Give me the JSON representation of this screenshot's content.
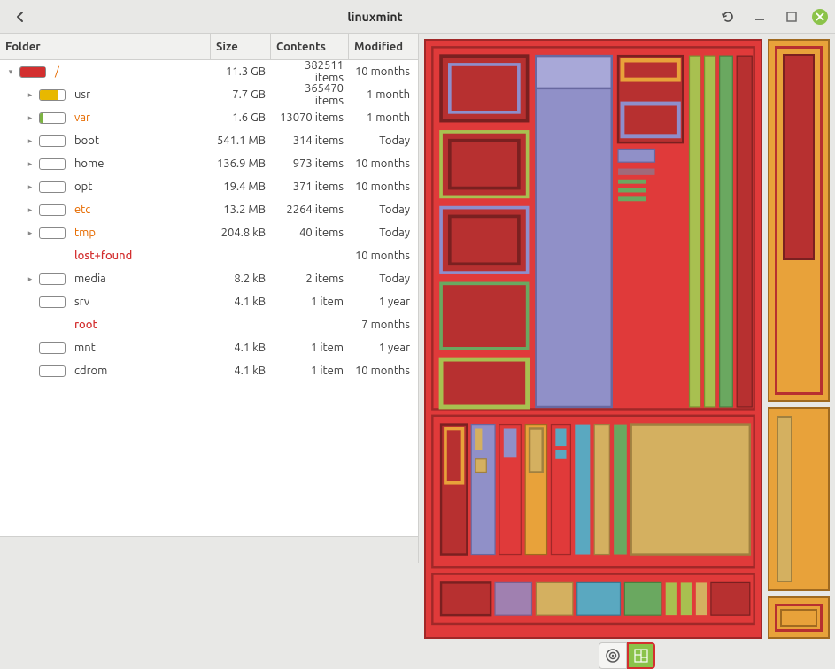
{
  "titlebar": {
    "title": "linuxmint"
  },
  "columns": {
    "folder": "Folder",
    "size": "Size",
    "contents": "Contents",
    "modified": "Modified"
  },
  "rows": [
    {
      "indent": 0,
      "expand": "down",
      "bar_fill": 100,
      "bar_color": "#d32f2f",
      "name": "/",
      "name_class": "orange",
      "size": "11.3 GB",
      "contents": "382511 items",
      "modified": "10 months"
    },
    {
      "indent": 1,
      "expand": "right",
      "bar_fill": 70,
      "bar_color": "#e8b800",
      "name": "usr",
      "name_class": "",
      "size": "7.7 GB",
      "contents": "365470 items",
      "modified": "1 month"
    },
    {
      "indent": 1,
      "expand": "right",
      "bar_fill": 15,
      "bar_color": "#7cb342",
      "name": "var",
      "name_class": "orange",
      "size": "1.6 GB",
      "contents": "13070 items",
      "modified": "1 month"
    },
    {
      "indent": 1,
      "expand": "right",
      "bar_fill": 0,
      "bar_color": "",
      "name": "boot",
      "name_class": "",
      "size": "541.1 MB",
      "contents": "314 items",
      "modified": "Today"
    },
    {
      "indent": 1,
      "expand": "right",
      "bar_fill": 0,
      "bar_color": "",
      "name": "home",
      "name_class": "",
      "size": "136.9 MB",
      "contents": "973 items",
      "modified": "10 months"
    },
    {
      "indent": 1,
      "expand": "right",
      "bar_fill": 0,
      "bar_color": "",
      "name": "opt",
      "name_class": "",
      "size": "19.4 MB",
      "contents": "371 items",
      "modified": "10 months"
    },
    {
      "indent": 1,
      "expand": "right",
      "bar_fill": 0,
      "bar_color": "",
      "name": "etc",
      "name_class": "orange",
      "size": "13.2 MB",
      "contents": "2264 items",
      "modified": "Today"
    },
    {
      "indent": 1,
      "expand": "right",
      "bar_fill": 0,
      "bar_color": "",
      "name": "tmp",
      "name_class": "orange",
      "size": "204.8 kB",
      "contents": "40 items",
      "modified": "Today"
    },
    {
      "indent": 1,
      "expand": "",
      "bar_fill": -1,
      "bar_color": "",
      "name": "lost+found",
      "name_class": "red",
      "size": "",
      "contents": "",
      "modified": "10 months"
    },
    {
      "indent": 1,
      "expand": "right",
      "bar_fill": 0,
      "bar_color": "",
      "name": "media",
      "name_class": "",
      "size": "8.2 kB",
      "contents": "2 items",
      "modified": "Today"
    },
    {
      "indent": 1,
      "expand": "",
      "bar_fill": 0,
      "bar_color": "",
      "name": "srv",
      "name_class": "",
      "size": "4.1 kB",
      "contents": "1 item",
      "modified": "1 year"
    },
    {
      "indent": 1,
      "expand": "",
      "bar_fill": -1,
      "bar_color": "",
      "name": "root",
      "name_class": "red",
      "size": "",
      "contents": "",
      "modified": "7 months"
    },
    {
      "indent": 1,
      "expand": "",
      "bar_fill": 0,
      "bar_color": "",
      "name": "mnt",
      "name_class": "",
      "size": "4.1 kB",
      "contents": "1 item",
      "modified": "1 year"
    },
    {
      "indent": 1,
      "expand": "",
      "bar_fill": 0,
      "bar_color": "",
      "name": "cdrom",
      "name_class": "",
      "size": "4.1 kB",
      "contents": "1 item",
      "modified": "10 months"
    }
  ]
}
